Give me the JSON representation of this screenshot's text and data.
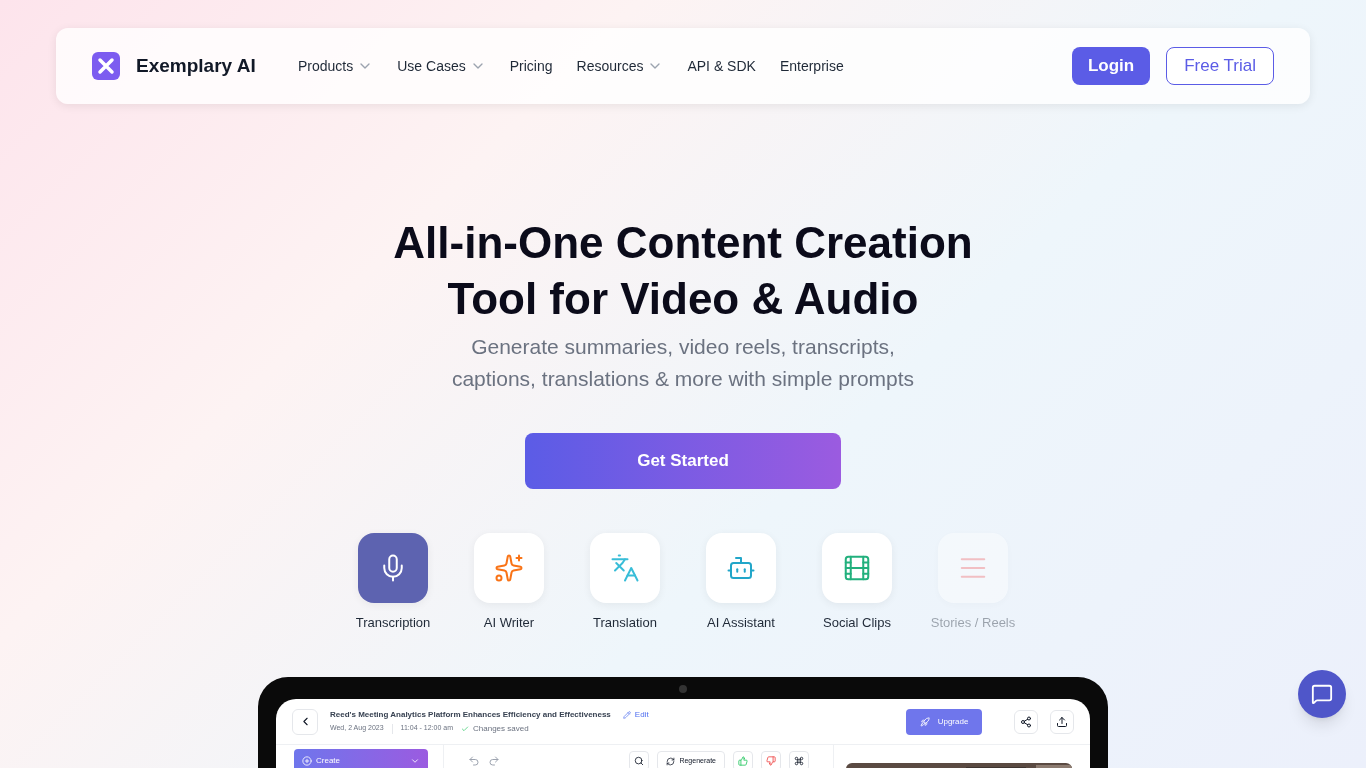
{
  "brand": {
    "name": "Exemplary AI"
  },
  "nav": [
    {
      "label": "Products",
      "has_menu": true
    },
    {
      "label": "Use Cases",
      "has_menu": true
    },
    {
      "label": "Pricing",
      "has_menu": false
    },
    {
      "label": "Resources",
      "has_menu": true
    },
    {
      "label": "API & SDK",
      "has_menu": false
    },
    {
      "label": "Enterprise",
      "has_menu": false
    }
  ],
  "auth": {
    "login": "Login",
    "trial": "Free Trial"
  },
  "hero": {
    "title_lines": [
      "All-in-One Content Creation",
      "Tool for Video & Audio"
    ],
    "subtitle_lines": [
      "Generate summaries, video reels, transcripts,",
      "captions, translations & more with simple prompts"
    ],
    "cta": "Get Started"
  },
  "features": [
    {
      "label": "Transcription",
      "kind": "transcription",
      "selected": true,
      "faded": false
    },
    {
      "label": "AI Writer",
      "kind": "writer",
      "selected": false,
      "faded": false
    },
    {
      "label": "Translation",
      "kind": "translation",
      "selected": false,
      "faded": false
    },
    {
      "label": "AI Assistant",
      "kind": "assistant",
      "selected": false,
      "faded": false
    },
    {
      "label": "Social Clips",
      "kind": "clips",
      "selected": false,
      "faded": false
    },
    {
      "label": "Stories / Reels",
      "kind": "stories",
      "selected": false,
      "faded": true
    }
  ],
  "app_preview": {
    "title": "Reed's Meeting Analytics Platform Enhances Efficiency and Effectiveness",
    "edit": "Edit",
    "date": "Wed, 2 Aug 2023",
    "time": "11:04 - 12:00 am",
    "status": "Changes saved",
    "upgrade": "Upgrade",
    "create": "Create",
    "regenerate": "Regenerate"
  }
}
